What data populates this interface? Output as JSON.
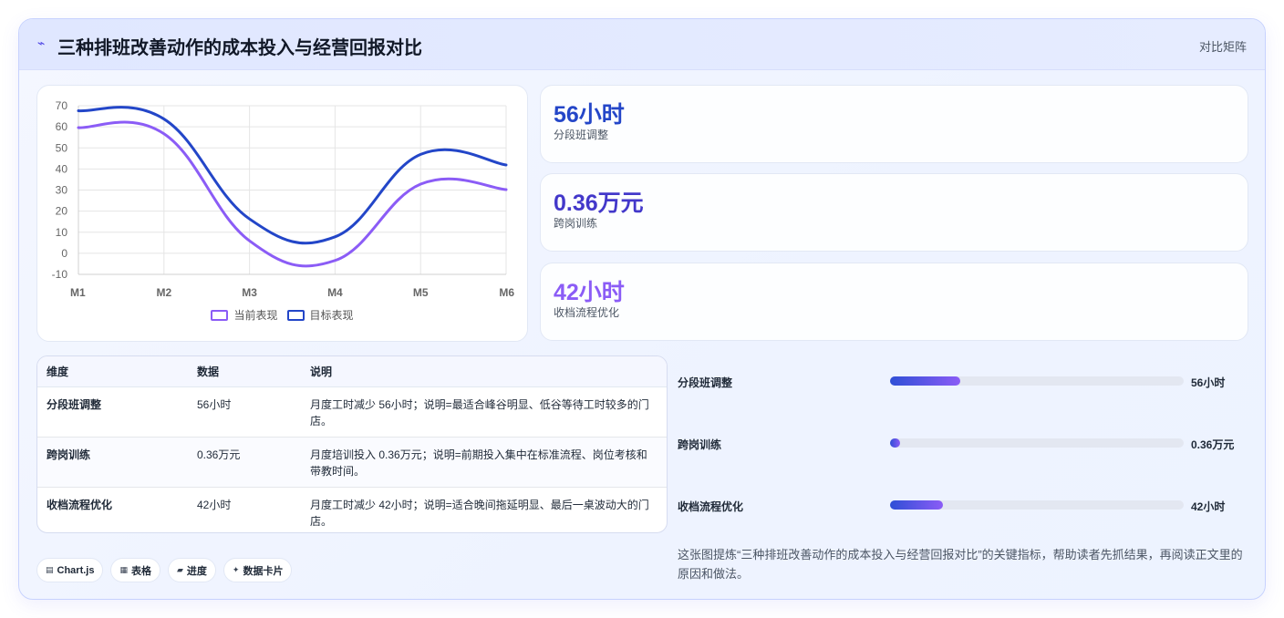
{
  "header": {
    "icon": "lightning-icon",
    "title": "三种排班改善动作的成本投入与经营回报对比",
    "tag": "对比矩阵"
  },
  "chart_data": {
    "type": "line",
    "categories": [
      "M1",
      "M2",
      "M3",
      "M4",
      "M5",
      "M6"
    ],
    "series": [
      {
        "name": "当前表现",
        "values": [
          59.6,
          56.7,
          5.9,
          -3.4,
          32.8,
          30.2
        ],
        "color": "#8b5cf6"
      },
      {
        "name": "目标表现",
        "values": [
          67.6,
          63.7,
          16.3,
          7.8,
          46.9,
          41.9
        ],
        "color": "#2346c8"
      }
    ],
    "ylim": [
      -10,
      70
    ],
    "yticks": [
      70,
      60,
      50,
      40,
      30,
      20,
      10,
      0,
      -10
    ],
    "grid": true,
    "legend": "bottom"
  },
  "stats": [
    {
      "value": "56小时",
      "label": "分段班调整",
      "color": "#2446c8"
    },
    {
      "value": "0.36万元",
      "label": "跨岗训练",
      "color": "#4338ca"
    },
    {
      "value": "42小时",
      "label": "收档流程优化",
      "color": "#8b5cf6"
    }
  ],
  "table": {
    "headers": [
      "维度",
      "数据",
      "说明"
    ],
    "rows": [
      [
        "分段班调整",
        "56小时",
        "月度工时减少 56小时；说明=最适合峰谷明显、低谷等待工时较多的门店。"
      ],
      [
        "跨岗训练",
        "0.36万元",
        "月度培训投入 0.36万元；说明=前期投入集中在标准流程、岗位考核和带教时间。"
      ],
      [
        "收档流程优化",
        "42小时",
        "月度工时减少 42小时；说明=适合晚间拖延明显、最后一桌波动大的门店。"
      ]
    ]
  },
  "progress": [
    {
      "label": "分段班调整",
      "value": "56小时",
      "fraction": 0.24
    },
    {
      "label": "跨岗训练",
      "value": "0.36万元",
      "fraction": 0.035
    },
    {
      "label": "收档流程优化",
      "value": "42小时",
      "fraction": 0.18
    }
  ],
  "chips": [
    {
      "icon": "chart-icon",
      "glyph": "▤",
      "label": "Chart.js"
    },
    {
      "icon": "table-icon",
      "glyph": "▦",
      "label": "表格"
    },
    {
      "icon": "progress-icon",
      "glyph": "▰",
      "label": "进度"
    },
    {
      "icon": "sparkle-icon",
      "glyph": "✦",
      "label": "数据卡片"
    }
  ],
  "summary": "这张图提炼“三种排班改善动作的成本投入与经营回报对比”的关键指标，帮助读者先抓结果，再阅读正文里的原因和做法。"
}
